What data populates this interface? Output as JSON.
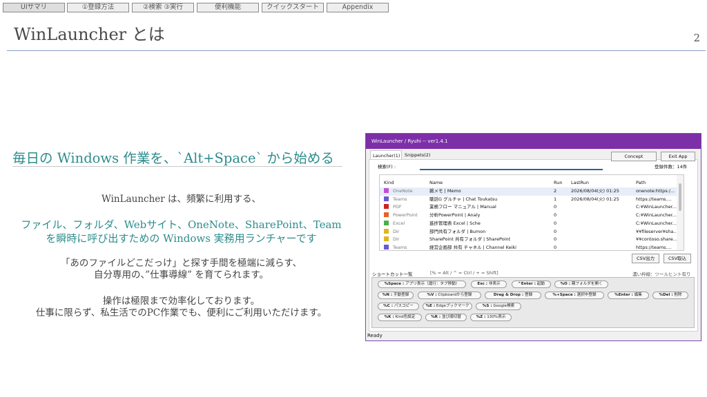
{
  "nav": {
    "tabs": [
      {
        "label": "UIサマリ",
        "active": true
      },
      {
        "label": "①登録方法"
      },
      {
        "label": "②検索 ③実行"
      },
      {
        "label": "便利機能"
      },
      {
        "label": "クイックスタート"
      },
      {
        "label": "Appendix"
      }
    ]
  },
  "slide": {
    "title": "WinLauncher とは",
    "page_number": "2",
    "headline": "毎日の Windows 作業を、`Alt+Space` から始める",
    "body": {
      "line1": "WinLauncher は、頻繁に利用する、",
      "line2": "ファイル、フォルダ、Webサイト、OneNote、SharePoint、Team",
      "line3": "を瞬時に呼び出すための Windows 実務用ランチャーです",
      "line4": "「あのファイルどこだっけ」と探す手間を極端に減らす、",
      "line5": "自分専用の、”仕事導線” を育てられます。",
      "line6": "操作は極限まで効率化しております。",
      "line7": "仕事に限らず、私生活でのPC作業でも、便利にご利用いただけます。"
    }
  },
  "app": {
    "title": "WinLauncher / Ryuhi -- ver1.4.1",
    "tabs": [
      "Launcher(1)",
      "Snippets(2)"
    ],
    "buttons": {
      "concept": "Concept",
      "exit": "Exit App",
      "csv_out": "CSV出力",
      "csv_in": "CSV取込"
    },
    "search": {
      "label": "検索(F) :",
      "value": ""
    },
    "count": "登録件数：14件",
    "columns": {
      "kind": "Kind",
      "name": "Name",
      "run": "Run",
      "lastrun": "LastRun",
      "path": "Path"
    },
    "rows": [
      {
        "kind": "OneNote",
        "color": "#c050d8",
        "name": "雑メモ | Memo",
        "run": "2",
        "lastrun": "2026/08/04(火) 01:25",
        "path": "onenote:https:/..."
      },
      {
        "kind": "Teams",
        "color": "#6a5ad0",
        "name": "聴話G グルチャ | Chat Toukatsu",
        "run": "1",
        "lastrun": "2026/08/04(火) 01:25",
        "path": "https://teams...."
      },
      {
        "kind": "PDF",
        "color": "#cc2222",
        "name": "業務フロー マニュアル | Manual",
        "run": "0",
        "lastrun": "",
        "path": "C:¥WinLauncher..."
      },
      {
        "kind": "PowerPoint",
        "color": "#e8602c",
        "name": "分析PowerPoint | Analy",
        "run": "0",
        "lastrun": "",
        "path": "C:¥WinLauncher..."
      },
      {
        "kind": "Excel",
        "color": "#49b049",
        "name": "進捗管理表 Excel | Sche",
        "run": "0",
        "lastrun": "",
        "path": "C:¥WinLauncher..."
      },
      {
        "kind": "Dir",
        "color": "#e2b520",
        "name": "部門共有フォルダ | Bumon",
        "run": "0",
        "lastrun": "",
        "path": "¥¥fileserver¥sha..."
      },
      {
        "kind": "Dir",
        "color": "#e2b520",
        "name": "SharePoint 共有フォルダ | SharePoint",
        "run": "0",
        "lastrun": "",
        "path": "¥¥contoso.share..."
      },
      {
        "kind": "Teams",
        "color": "#6a5ad0",
        "name": "経営企画部 共有 チャネル | Channel Keiki",
        "run": "0",
        "lastrun": "",
        "path": "https://teams...."
      }
    ],
    "shortcut_title": "ショートカット一覧",
    "shortcut_legend": "[% = Alt / ^ = Ctrl / + = Shift]",
    "shortcut_hint": "濃い枠線：ツールヒント有り",
    "shortcuts": [
      {
        "key": "%Space :",
        "desc": "アプリ表示（運行：タブ移動）"
      },
      {
        "key": "Esc :",
        "desc": "非表示"
      },
      {
        "key": "^Enter :",
        "desc": "起動"
      },
      {
        "key": "%O :",
        "desc": "親フォルダを開く"
      },
      {
        "key": "%N :",
        "desc": "手動登録"
      },
      {
        "key": "%V :",
        "desc": "Clipboardから登録"
      },
      {
        "key": "Drag & Drop :",
        "desc": "登録"
      },
      {
        "key": "%+Space :",
        "desc": "選択中登録"
      },
      {
        "key": "%Enter :",
        "desc": "編集"
      },
      {
        "key": "%Del :",
        "desc": "削除"
      },
      {
        "key": "%C :",
        "desc": "パスコピー"
      },
      {
        "key": "%E :",
        "desc": "Edgeブックマーク"
      },
      {
        "key": "%S :",
        "desc": "Google検索"
      },
      {
        "key": "%K :",
        "desc": "Kind色設定"
      },
      {
        "key": "%R :",
        "desc": "並び順切替"
      },
      {
        "key": "%Z :",
        "desc": "130%表示"
      }
    ],
    "status": "Ready"
  }
}
